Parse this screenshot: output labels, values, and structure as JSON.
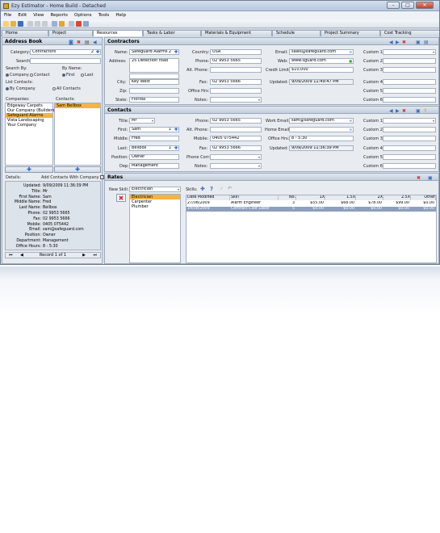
{
  "window": {
    "title": "Ezy Estimator - Home Build - Detached"
  },
  "menu": [
    "File",
    "Edit",
    "View",
    "Reports",
    "Options",
    "Tools",
    "Help"
  ],
  "tabs": [
    "Home",
    "Project",
    "Resources",
    "Tasks & Labor",
    "Materials & Equipment",
    "Schedule",
    "Project Summary",
    "Cost Tracking"
  ],
  "address_book": {
    "header": "Address Book",
    "category_label": "Category:",
    "category_value": "Contractors",
    "category_count": "2",
    "search_label": "Search:",
    "search_by_label": "Search By:",
    "by_name_label": "By Name:",
    "radio_company": "Company",
    "radio_contact": "Contact",
    "radio_first": "First",
    "radio_last": "Last",
    "list_contacts_label": "List Contacts:",
    "radio_by_company": "By Company",
    "radio_all_contacts": "All Contacts",
    "companies_label": "Companies:",
    "contacts_label": "Contacts:",
    "companies": [
      "Edgeway Carpets",
      "Our Company (Builders)",
      "Safeguard Alarms",
      "Vista Landscaping",
      "Your Company"
    ],
    "contacts": [
      "Sam Bellbox"
    ],
    "details_label": "Details:",
    "add_contacts_label": "Add Contacts With Company",
    "details": [
      [
        "Updated:",
        "9/09/2009 11:36:39 PM"
      ],
      [
        "Title:",
        "Mr"
      ],
      [
        "First Name:",
        "Sam"
      ],
      [
        "Middle Name:",
        "Fred"
      ],
      [
        "Last Name:",
        "Bellbox"
      ],
      [
        "Phone:",
        "02 9953 5665"
      ],
      [
        "Fax:",
        "02 9953 5666"
      ],
      [
        "Mobile:",
        "0405 075442"
      ],
      [
        "Email:",
        "sam@safeguard.com"
      ],
      [
        "Position:",
        "Owner"
      ],
      [
        "Department:",
        "Management"
      ],
      [
        "Office Hours:",
        "8 - 5:30"
      ]
    ],
    "record": "Record 1 of 1"
  },
  "contractors": {
    "header": "Contractors",
    "name_label": "Name:",
    "name": "Safeguard Alarms",
    "name_count": "2",
    "address_label": "Address:",
    "address": "25 Detection road",
    "city_label": "City:",
    "city": "Key West",
    "zip_label": "Zip:",
    "zip": "",
    "state_label": "State:",
    "state": "Florida",
    "country_label": "Country:",
    "country": "USA",
    "phone_label": "Phone:",
    "phone": "02 9953 5665",
    "altphone_label": "Alt. Phone:",
    "altphone": "",
    "fax_label": "Fax:",
    "fax": "02 9953 5666",
    "officehrs_label": "Office Hrs:",
    "officehrs": "",
    "notes_label": "Notes:",
    "email_label": "Email:",
    "email": "sales@safeguard.com",
    "web_label": "Web:",
    "web": "www.sguard.com",
    "credit_label": "Credit Limit:",
    "credit": "$10,000",
    "updated_label": "Updated:",
    "updated": "9/09/2009 11:49:47 PM",
    "custom": [
      "Custom 1",
      "Custom 2",
      "Custom 3",
      "Custom 4",
      "Custom 5",
      "Custom 6"
    ]
  },
  "contacts": {
    "header": "Contacts",
    "title_label": "Title:",
    "title": "Mr",
    "first_label": "First:",
    "first": "Sam",
    "first_count": "1",
    "middle_label": "Middle:",
    "middle": "Fred",
    "last_label": "Last:",
    "last": "Bellbox",
    "last_count": "1",
    "position_label": "Position:",
    "position": "Owner",
    "dep_label": "Dep:",
    "dep": "Management",
    "phone_label": "Phone:",
    "phone": "02 9953 5665",
    "altphone_label": "Alt. Phone:",
    "altphone": "",
    "mobile_label": "Mobile:",
    "mobile": "0405 075442",
    "fax_label": "Fax:",
    "fax": "02 9953 5666",
    "phonecorr_label": "Phone Corr:",
    "notes_label": "Notes:",
    "workemail_label": "Work Email:",
    "workemail": "sam@safeguard.com",
    "homeemail_label": "Home Email:",
    "homeemail": "",
    "officehrs_label": "Office Hrs:",
    "officehrs": "8 - 5:30",
    "updated_label": "Updated:",
    "updated": "9/09/2009 11:36:39 PM",
    "custom": [
      "Custom 1",
      "Custom 2",
      "Custom 3",
      "Custom 4",
      "Custom 5",
      "Custom 6"
    ]
  },
  "rates": {
    "header": "Rates",
    "newskill_label": "New Skill:",
    "newskill": "Electrician",
    "skills_label": "Skills:",
    "skill_list": [
      "Electrician",
      "Carpenter",
      "Plumber"
    ],
    "columns": [
      "Date Modified",
      "Skill",
      "No.",
      "1X",
      "1.5X",
      "2X",
      "2.5X",
      "Other"
    ],
    "rows": [
      [
        "27/08/2009",
        "Alarm Engineer",
        "3",
        "$55.00",
        "$68.00",
        "$78.00",
        "$99.00",
        "$0.00"
      ],
      [
        "14/08/2009",
        "Contract Cust Labor",
        "5",
        "$0.00",
        "$0.00",
        "$0.00",
        "$0.00",
        "$0.00"
      ]
    ]
  }
}
